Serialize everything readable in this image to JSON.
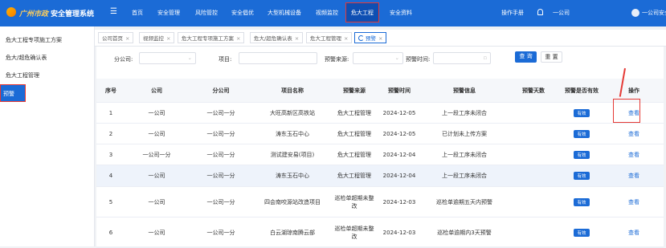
{
  "header": {
    "brand_sub": "广州市政",
    "brand_title": "安全管理系统",
    "nav": [
      "首页",
      "安全管理",
      "风险管控",
      "安全倡优",
      "大型机械设备",
      "视频监控",
      "危大工程",
      "安全资料"
    ],
    "active_nav": "危大工程",
    "manual": "操作手册",
    "company": "一公司",
    "user": "一公司安全员"
  },
  "sidebar": {
    "items": [
      "危大工程专项施工方案",
      "危大/超危确认表",
      "危大工程管理",
      "预警"
    ],
    "active": "预警"
  },
  "tabs": [
    "公司首页",
    "视频监控",
    "危大工程专项施工方案",
    "危大/超危确认表",
    "危大工程管理",
    "预警"
  ],
  "filters": {
    "subcompany_label": "分公司:",
    "project_label": "项目:",
    "source_label": "预警来源:",
    "time_label": "预警时间:",
    "search_btn": "查 询",
    "reset_btn": "重 置"
  },
  "table": {
    "columns": [
      "序号",
      "公司",
      "分公司",
      "项目名称",
      "预警来源",
      "预警时间",
      "预警信息",
      "预警天数",
      "预警是否有效",
      "操作"
    ],
    "rows": [
      {
        "no": "1",
        "company": "一公司",
        "branch": "一公司一分",
        "project": "大旺高新区高铁站",
        "source": "危大工程管理",
        "time": "2024-12-05",
        "info": "上一段工序未闭合",
        "days": "",
        "valid": "有效",
        "action": "查看"
      },
      {
        "no": "2",
        "company": "一公司",
        "branch": "一公司一分",
        "project": "涛东玉石中心",
        "source": "危大工程管理",
        "time": "2024-12-05",
        "info": "已计划未上传方案",
        "days": "",
        "valid": "有效",
        "action": "查看"
      },
      {
        "no": "3",
        "company": "一公司一分",
        "branch": "一公司一分",
        "project": "测试建安易(项目)",
        "source": "危大工程管理",
        "time": "2024-12-04",
        "info": "上一段工序未闭合",
        "days": "",
        "valid": "有效",
        "action": "查看"
      },
      {
        "no": "4",
        "company": "一公司",
        "branch": "一公司一分",
        "project": "涛东玉石中心",
        "source": "危大工程管理",
        "time": "2024-12-04",
        "info": "上一段工序未闭合",
        "days": "",
        "valid": "有效",
        "action": "查看"
      },
      {
        "no": "5",
        "company": "一公司",
        "branch": "一公司一分",
        "project": "四会南咬源站改造项目",
        "source": "巡检单超期未整改",
        "time": "2024-12-03",
        "info": "巡检单逾期五天内预警",
        "days": "",
        "valid": "有效",
        "action": "查看"
      },
      {
        "no": "6",
        "company": "一公司",
        "branch": "一公司一分",
        "project": "白云湖琼南腾云部",
        "source": "巡检单超期未整改",
        "time": "2024-12-03",
        "info": "巡检单逾期内3天预警",
        "days": "",
        "valid": "有效",
        "action": "查看"
      }
    ]
  }
}
